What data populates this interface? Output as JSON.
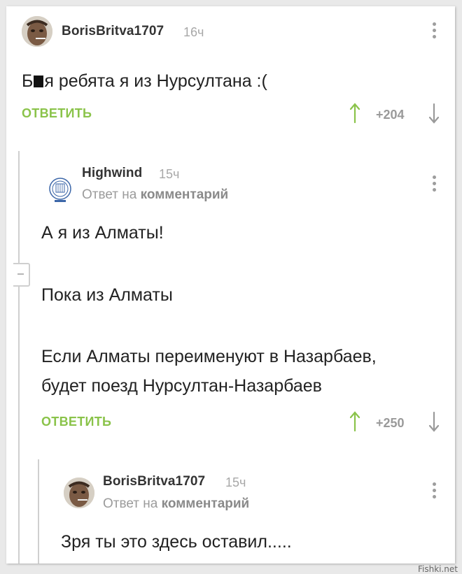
{
  "comments": [
    {
      "username": "BorisBritva1707",
      "time": "16ч",
      "text_prefix": "Б",
      "text_suffix": "я ребята я из Нурсултана :(",
      "reply_label": "ОТВЕТИТЬ",
      "rating": "+204"
    },
    {
      "username": "Highwind",
      "time": "15ч",
      "reply_to_prefix": "Ответ на",
      "reply_to_link": "комментарий",
      "paragraphs": [
        "А я из Алматы!",
        "Пока из Алматы",
        "Если Алматы переименуют в Назарбаев,",
        "будет поезд Нурсултан-Назарбаев"
      ],
      "reply_label": "ОТВЕТИТЬ",
      "rating": "+250"
    },
    {
      "username": "BorisBritva1707",
      "time": "15ч",
      "reply_to_prefix": "Ответ на",
      "reply_to_link": "комментарий",
      "text": "Зря ты это здесь оставил....."
    }
  ],
  "watermark": "Fishki.net",
  "colors": {
    "accent_green": "#8ac34a",
    "meta_gray": "#a8a8a8",
    "text": "#222222"
  },
  "icons": [
    "kebab-menu-icon",
    "upvote-arrow-icon",
    "downvote-arrow-icon",
    "collapse-thread-icon"
  ]
}
